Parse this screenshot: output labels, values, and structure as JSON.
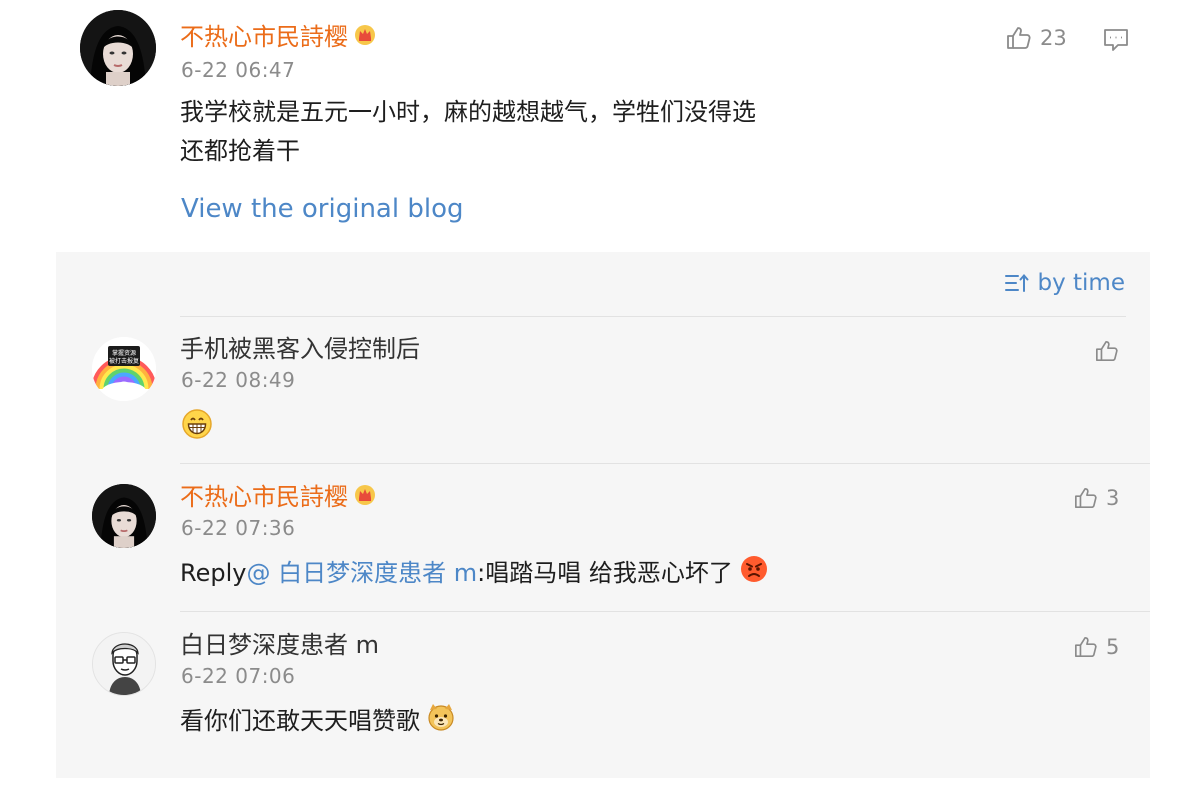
{
  "post": {
    "author": "不热心市民詩樱",
    "time": "6-22 06:47",
    "text_line1": "我学校就是五元一小时，麻的越想越气，学牲们没得选",
    "text_line2": "还都抢着干",
    "likes": "23",
    "view_original": "View the original blog"
  },
  "sort_label": "by time",
  "replies": [
    {
      "author": "手机被黑客入侵控制后",
      "time": "6-22 08:49",
      "likes": "",
      "avatar_badge_line1": "掌握资源",
      "avatar_badge_line2": "被打击报复"
    },
    {
      "author": "不热心市民詩樱",
      "time": "6-22 07:36",
      "likes": "3",
      "reply_prefix": "Reply",
      "mention": "@ 白日梦深度患者 m",
      "text": ":唱踏马唱 给我恶心坏了"
    },
    {
      "author": "白日梦深度患者 m",
      "time": "6-22 07:06",
      "likes": "5",
      "text": "看你们还敢天天唱赞歌"
    }
  ],
  "icons": {
    "like": "thumbs-up-icon",
    "comment": "comment-icon",
    "sort": "sort-icon",
    "crown": "crown-badge-icon",
    "grin": "grin-emoji-icon",
    "angry": "angry-emoji-icon",
    "doge": "doge-emoji-icon"
  },
  "colors": {
    "name_orange": "#eb6c19",
    "link_blue": "#4d87c7",
    "meta_gray": "#8b8b8b",
    "panel_bg": "#f6f6f6"
  }
}
